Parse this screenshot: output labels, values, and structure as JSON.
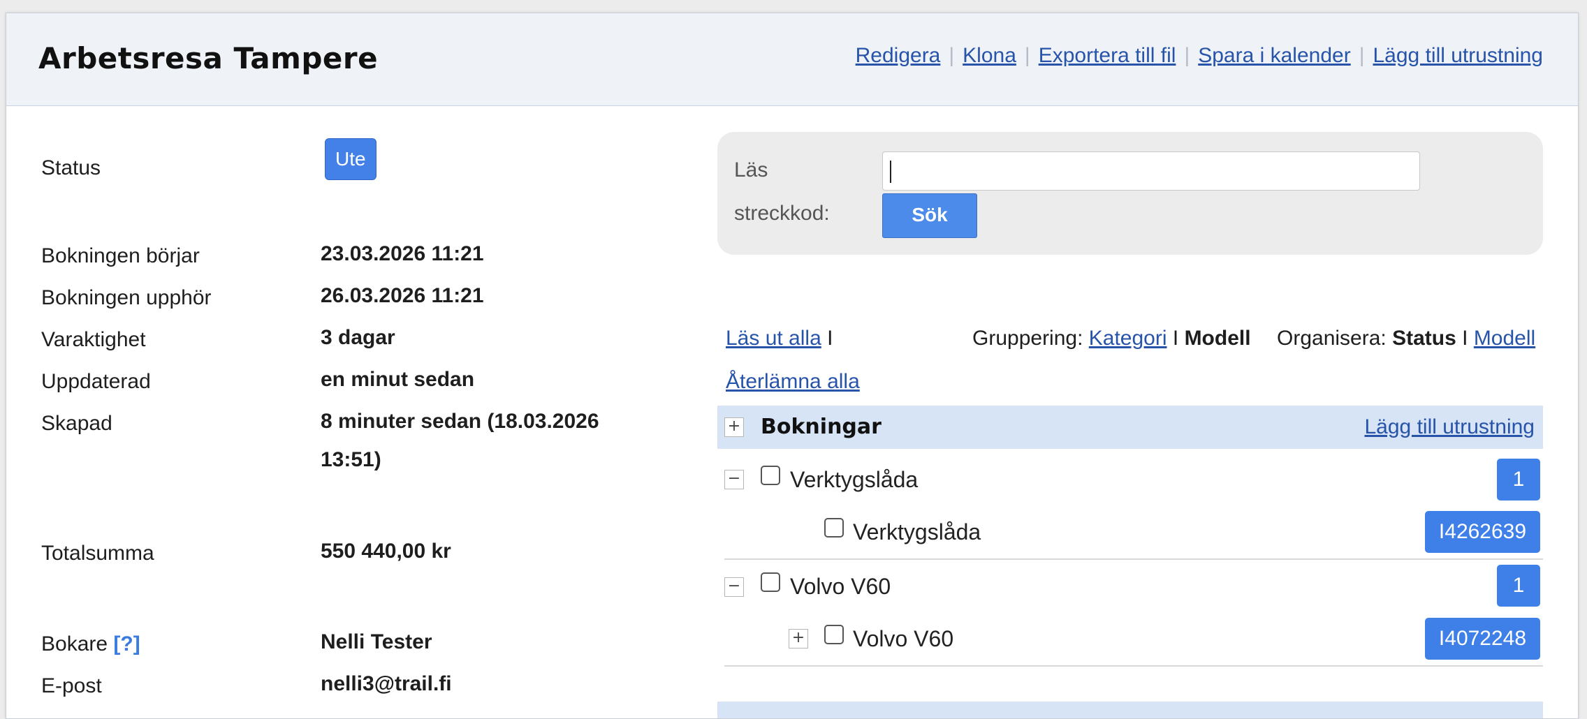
{
  "header": {
    "title": "Arbetsresa Tampere",
    "actions": [
      "Redigera",
      "Klona",
      "Exportera till fil",
      "Spara i kalender",
      "Lägg till utrustning"
    ]
  },
  "info": {
    "status_label": "Status",
    "status_value": "Ute",
    "start_label": "Bokningen börjar",
    "start_value": "23.03.2026 11:21",
    "end_label": "Bokningen upphör",
    "end_value": "26.03.2026 11:21",
    "duration_label": "Varaktighet",
    "duration_value": "3 dagar",
    "updated_label": "Uppdaterad",
    "updated_value": "en minut sedan",
    "created_label": "Skapad",
    "created_value_line1": "8 minuter sedan (18.03.2026",
    "created_value_line2": "13:51)",
    "total_label": "Totalsumma",
    "total_value": "550 440,00 kr",
    "booker_label": "Bokare",
    "booker_help": "[?]",
    "booker_value": "Nelli Tester",
    "email_label": "E-post",
    "email_value": "nelli3@trail.fi"
  },
  "scan": {
    "label_line1": "Läs",
    "label_line2": "streckkod:",
    "input_value": "",
    "button": "Sök"
  },
  "controls": {
    "checkout_all": "Läs ut alla",
    "return_all": "Återlämna alla",
    "grouping_label": "Gruppering:",
    "grouping_category": "Kategori",
    "grouping_model": "Modell",
    "organize_label": "Organisera:",
    "organize_status": "Status",
    "organize_model": "Modell",
    "divider": "I"
  },
  "group": {
    "title": "Bokningar",
    "add_link": "Lägg till utrustning",
    "expand_symbol": "+",
    "collapse_symbol": "−",
    "items": [
      {
        "model": "Verktygslåda",
        "count": "1",
        "unit": "Verktygslåda",
        "unit_id": "I4262639"
      },
      {
        "model": "Volvo V60",
        "count": "1",
        "unit": "Volvo V60",
        "unit_id": "I4072248"
      }
    ]
  },
  "colors": {
    "accent": "#4381e8",
    "link": "#2753a9",
    "header_bg": "#eff3f8",
    "group_bar_bg": "#d6e4f5"
  }
}
